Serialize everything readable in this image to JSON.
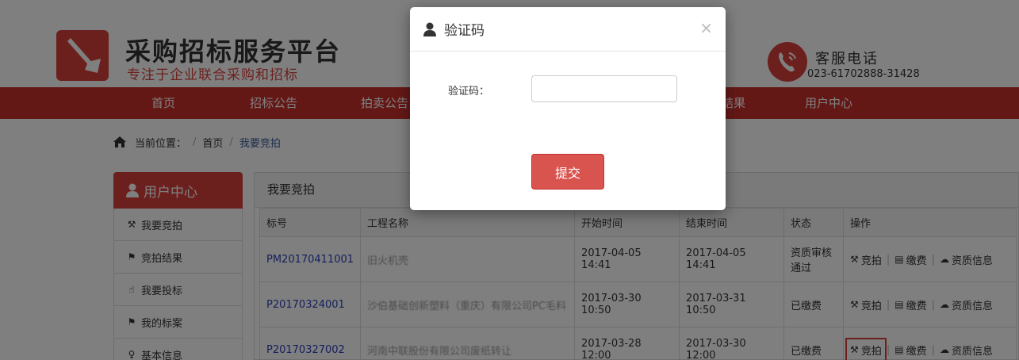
{
  "header": {
    "title": "采购招标服务平台",
    "subtitle": "专注于企业联合采购和招标",
    "phone_label": "客服电话",
    "phone_number": "023-61702888-31428"
  },
  "nav": {
    "items": [
      "首页",
      "招标公告",
      "拍卖公告",
      "结果",
      "用户中心"
    ]
  },
  "breadcrumb": {
    "label": "当前位置：",
    "home": "首页",
    "current": "我要竞拍"
  },
  "sidebar": {
    "title": "用户中心",
    "items": [
      {
        "label": "我要竞拍",
        "icon": "gavel-icon"
      },
      {
        "label": "竞拍结果",
        "icon": "flag-icon"
      },
      {
        "label": "我要投标",
        "icon": "hand-pointer-icon"
      },
      {
        "label": "我的标案",
        "icon": "flag-icon"
      },
      {
        "label": "基本信息",
        "icon": "lightbulb-icon"
      }
    ]
  },
  "panel": {
    "title": "我要竞拍",
    "columns": [
      "标号",
      "工程名称",
      "开始时间",
      "结束时间",
      "状态",
      "操作"
    ],
    "rows": [
      {
        "code": "PM20170411001",
        "name": "旧火机壳",
        "start": "2017-04-05 14:41",
        "end": "2017-04-05 14:41",
        "status": "资质审核通过"
      },
      {
        "code": "P20170324001",
        "name": "沙伯基础创新塑料（重庆）有限公司PC毛料",
        "start": "2017-03-30 10:50",
        "end": "2017-03-31 10:50",
        "status": "已缴费"
      },
      {
        "code": "P20170327002",
        "name": "河南中联股份有限公司废纸转让",
        "start": "2017-03-28 12:00",
        "end": "2017-03-30 12:00",
        "status": "已缴费"
      }
    ],
    "actions": {
      "bid": "竞拍",
      "pay": "缴费",
      "qualification": "资质信息"
    }
  },
  "modal": {
    "title": "验证码",
    "field_label": "验证码：",
    "input_value": "",
    "submit_label": "提交",
    "close_symbol": "×"
  },
  "colors": {
    "brand_red": "#d9413a",
    "nav_red": "#c9302c",
    "link_blue": "#2a3fb8"
  }
}
